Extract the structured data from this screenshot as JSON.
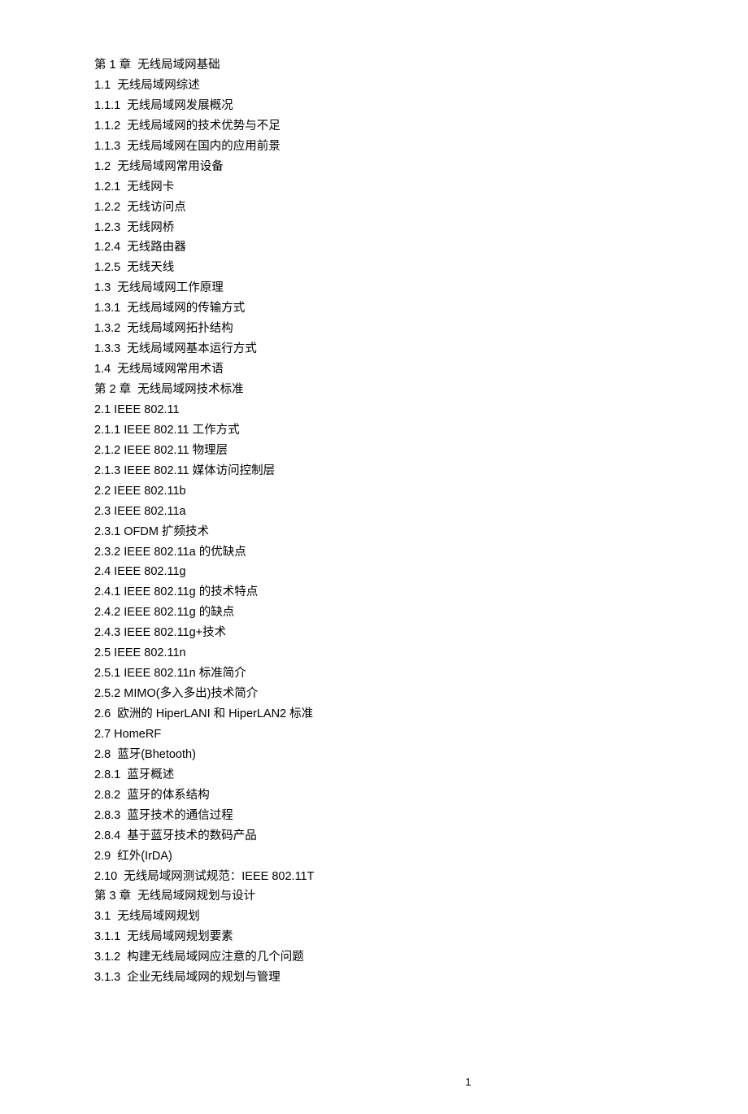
{
  "toc": [
    "第 1 章  无线局域网基础",
    "1.1  无线局域网综述",
    "1.1.1  无线局域网发展概况",
    "1.1.2  无线局域网的技术优势与不足",
    "1.1.3  无线局域网在国内的应用前景",
    "1.2  无线局域网常用设备",
    "1.2.1  无线网卡",
    "1.2.2  无线访问点",
    "1.2.3  无线网桥",
    "1.2.4  无线路由器",
    "1.2.5  无线天线",
    "1.3  无线局域网工作原理",
    "1.3.1  无线局域网的传输方式",
    "1.3.2  无线局域网拓扑结构",
    "1.3.3  无线局域网基本运行方式",
    "1.4  无线局域网常用术语",
    "第 2 章  无线局域网技术标准",
    "2.1 IEEE 802.11",
    "2.1.1 IEEE 802.11 工作方式",
    "2.1.2 IEEE 802.11 物理层",
    "2.1.3 IEEE 802.11 媒体访问控制层",
    "2.2 IEEE 802.11b",
    "2.3 IEEE 802.11a",
    "2.3.1 OFDM 扩频技术",
    "2.3.2 IEEE 802.11a 的优缺点",
    "2.4 IEEE 802.11g",
    "2.4.1 IEEE 802.11g 的技术特点",
    "2.4.2 IEEE 802.11g 的缺点",
    "2.4.3 IEEE 802.11g+技术",
    "2.5 IEEE 802.11n",
    "2.5.1 IEEE 802.11n 标准简介",
    "2.5.2 MIMO(多入多出)技术简介",
    "2.6  欧洲的 HiperLANI 和 HiperLAN2 标准",
    "2.7 HomeRF",
    "2.8  蓝牙(Bhetooth)",
    "2.8.1  蓝牙概述",
    "2.8.2  蓝牙的体系结构",
    "2.8.3  蓝牙技术的通信过程",
    "2.8.4  基于蓝牙技术的数码产品",
    "2.9  红外(IrDA)",
    "2.10  无线局域网测试规范：IEEE 802.11T",
    "第 3 章  无线局域网规划与设计",
    "3.1  无线局域网规划",
    "3.1.1  无线局域网规划要素",
    "3.1.2  构建无线局域网应注意的几个问题",
    "3.1.3  企业无线局域网的规划与管理"
  ],
  "page_number": "1"
}
